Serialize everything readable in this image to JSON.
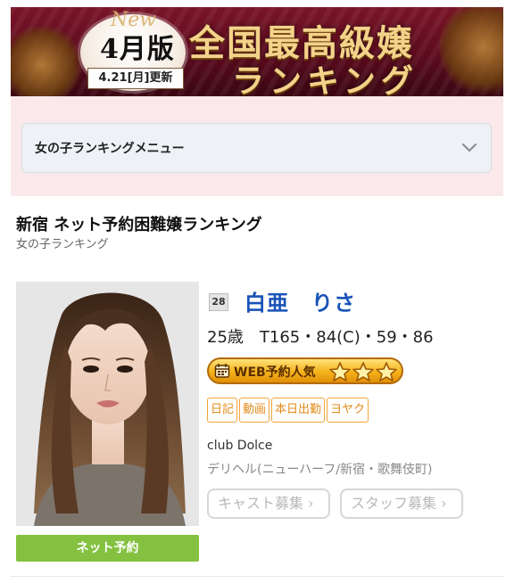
{
  "banner": {
    "new_label": "New",
    "month_label": "4月版",
    "date_label": "4.21[月]更新",
    "title_line1": "全国最高級嬢",
    "title_line2": "ランキング"
  },
  "menu": {
    "label": "女の子ランキングメニュー",
    "icon": "chevron-down-icon"
  },
  "page": {
    "title": "新宿 ネット予約困難嬢ランキング",
    "subtitle": "女の子ランキング"
  },
  "girl": {
    "rank": "28",
    "name": "白亜　りさ",
    "stats": "25歳　T165・84(C)・59・86",
    "web_popularity_label": "WEB予約人気",
    "web_popularity_stars": 3,
    "tags": [
      "日記",
      "動画",
      "本日出勤",
      "ヨヤク"
    ],
    "club": "club Dolce",
    "genre": "デリヘル(ニューハーフ/新宿・歌舞伎町)",
    "reserve_button": "ネット予約",
    "cast_recruit_button": "キャスト募集",
    "staff_recruit_button": "スタッフ募集"
  },
  "colors": {
    "accent_blue": "#1a53b8",
    "reserve_green": "#84c140",
    "tag_orange": "#e08a1a",
    "menu_pink": "#fbe8ea",
    "banner_red": "#7a1428"
  }
}
